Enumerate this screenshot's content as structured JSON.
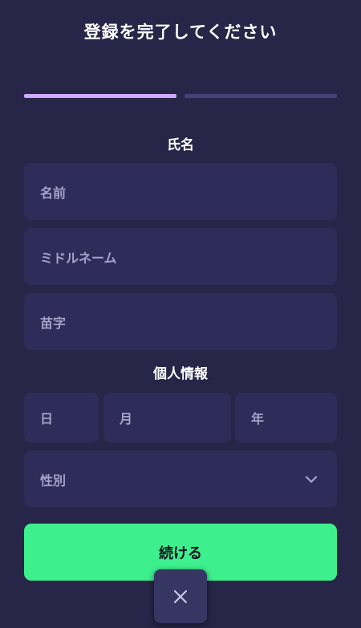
{
  "header": {
    "title": "登録を完了してください"
  },
  "progress": {
    "steps_total": 2,
    "current_step": 1,
    "active_color": "#cfa8ff",
    "inactive_color": "#47427a"
  },
  "name_section": {
    "title": "氏名",
    "first_name_placeholder": "名前",
    "middle_name_placeholder": "ミドルネーム",
    "last_name_placeholder": "苗字"
  },
  "personal_section": {
    "title": "個人情報",
    "day_placeholder": "日",
    "month_placeholder": "月",
    "year_placeholder": "年",
    "gender_placeholder": "性別"
  },
  "actions": {
    "continue_label": "続ける",
    "continue_color": "#3ef08d"
  },
  "icons": {
    "dropdown": "chevron-down-icon",
    "close": "close-icon"
  },
  "colors": {
    "background": "#272648",
    "field_background": "#2e2d5a"
  }
}
